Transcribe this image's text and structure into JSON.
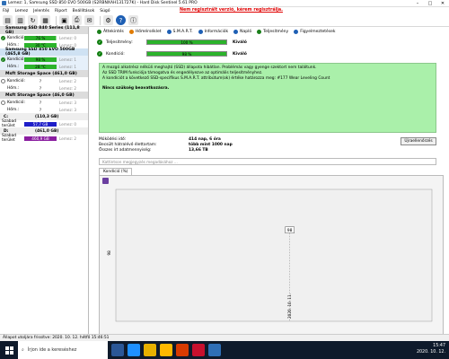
{
  "window": {
    "title": "Lemez: 1, Samsung SSD 850 EVO 500GB (S2RBNXAH131727K) - Hard Disk Sentinel 5.61 PRO"
  },
  "menu": {
    "items": [
      "Fájl",
      "Lemez",
      "Jelentés",
      "Riport",
      "Beállítások",
      "Súgó"
    ],
    "not_registered": "Nem regisztrált verzió, kérem regisztrálja."
  },
  "drives": [
    {
      "name": "Samsung SSD 840 Series (111,8 GB)",
      "selected": false,
      "rows": [
        {
          "label": "Kondíció:",
          "bar_text": "76 %",
          "value": "Lemez: 0",
          "bar_color": "#2bb32b"
        },
        {
          "label": "Hőm.:",
          "bar_text": "30 °C",
          "value": "Lemez: 0",
          "bar_color": "#2bb32b"
        }
      ]
    },
    {
      "name": "Samsung SSD 850 EVO 500GB (465,8 GB)",
      "selected": true,
      "rows": [
        {
          "label": "Kondíció:",
          "bar_text": "98 %",
          "value": "Lemez: 1",
          "bar_color": "#2bb32b"
        },
        {
          "label": "Hőm.:",
          "bar_text": "28 °C",
          "value": "Lemez: 1",
          "bar_color": "#2bb32b"
        }
      ]
    },
    {
      "name": "Msft   Storage Space (461,0 GB)",
      "selected": false,
      "rows": [
        {
          "label": "Kondíció:",
          "bar_text": "?",
          "value": "Lemez: 2",
          "bar_color": ""
        },
        {
          "label": "Hőm.:",
          "bar_text": "?",
          "value": "Lemez: 2",
          "bar_color": ""
        }
      ]
    },
    {
      "name": "Msft   Storage Space (46,0 GB)",
      "selected": false,
      "rows": [
        {
          "label": "Kondíció:",
          "bar_text": "?",
          "value": "Lemez: 3",
          "bar_color": ""
        },
        {
          "label": "Hőm.:",
          "bar_text": "?",
          "value": "Lemez: 3",
          "bar_color": ""
        }
      ]
    }
  ],
  "volumes": [
    {
      "name": "C:",
      "size": "(110,3 GB)",
      "free_label": "Szabad terület",
      "free": "57,7 GB",
      "disk": "Lemez: 0",
      "free_color": "#1e1ec8"
    },
    {
      "name": "D:",
      "size": "(461,0 GB)",
      "free_label": "Szabad terület",
      "free": "460,9 GB",
      "disk": "Lemez: 2",
      "free_color": "#8a1ea0"
    }
  ],
  "tabs": [
    {
      "label": "Áttekintés",
      "color": "#1a7f1a"
    },
    {
      "label": "Hőmérséklet",
      "color": "#e07b00"
    },
    {
      "label": "S.M.A.R.T.",
      "color": "#1e5fb4"
    },
    {
      "label": "Információk",
      "color": "#1e5fb4"
    },
    {
      "label": "Napló",
      "color": "#1e5fb4"
    },
    {
      "label": "Teljesítmény",
      "color": "#1a7f1a"
    },
    {
      "label": "Figyelmeztetések",
      "color": "#1e5fb4"
    }
  ],
  "performance": {
    "label": "Teljesítmény:",
    "bar_text": "100 %",
    "value": "Kiváló",
    "level": 100
  },
  "condition": {
    "label": "Kondíció:",
    "bar_text": "98 %",
    "value": "Kiváló",
    "level": 98
  },
  "info": {
    "lines": [
      "A mozgó alkatrész nélküli meghajtó (SSD) állapota hibátlan. Problémás vagy gyenge szektort nem találtunk.",
      "Az SSD TRIM funkciója támogatva és engedélyezve az optimális teljesítményhez.",
      "A kondíciót a következő SSD-specifikus S.M.A.R.T. attribútum(ok) értéke határozza meg:  #177 Wear Leveling Count"
    ],
    "no_action": "Nincs szükség beavatkozásra."
  },
  "stats": [
    {
      "label": "Működési idő:",
      "value": "414 nap, 6 óra"
    },
    {
      "label": "Becsült hátralévő élettartam:",
      "value": "több mint 1000 nap"
    },
    {
      "label": "Összes írt adatmennyiség:",
      "value": "13,66 TB"
    }
  ],
  "refresh_label": "Újraellenőrzés",
  "comment_placeholder": "Kattintson megjegyzés megadásához ...",
  "subtab_label": "Kondíció  (%)",
  "chart_data": {
    "type": "line",
    "x": [
      "2020. 10. 11."
    ],
    "series": [
      {
        "values": [
          98
        ]
      }
    ],
    "ylabel": "",
    "point_labels": [
      "98"
    ]
  },
  "statusbar": "Állapot utoljára frissítve: 2020. 10. 12. hétfő 15:46:51",
  "taskbar": {
    "search_placeholder": "Írjon ide a kereséshez",
    "time": "15:47",
    "date": "2020. 10. 12."
  },
  "colors": {
    "good": "#2bb32b",
    "info_bg": "#aaf0aa",
    "title_red": "#e00000"
  }
}
